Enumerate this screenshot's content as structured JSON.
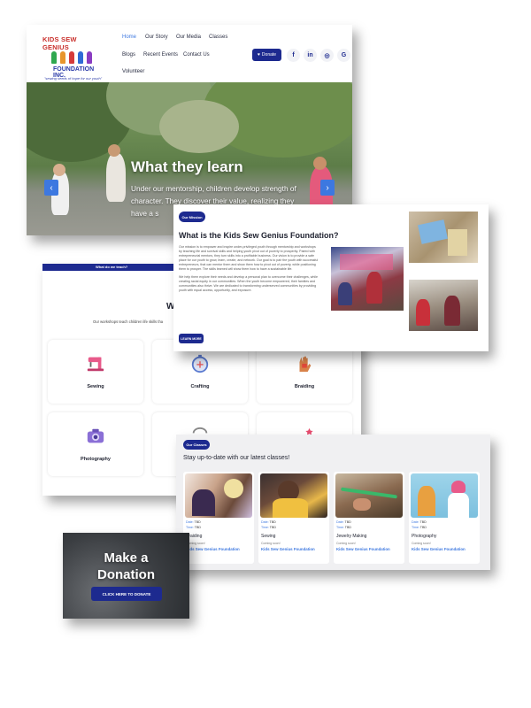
{
  "header": {
    "logo": {
      "arc": "KIDS SEW GENIUS",
      "foundation": "FOUNDATION INC.",
      "tagline": "\"sewing seeds of hope for our youth\""
    },
    "nav": [
      "Home",
      "Our Story",
      "Our Media",
      "Classes",
      "Blogs",
      "Recent Events",
      "Contact Us",
      "Volunteer"
    ],
    "donate_label": "Donate",
    "social_icons": [
      "facebook-icon",
      "linkedin-icon",
      "instagram-icon",
      "google-icon"
    ],
    "hero": {
      "title": "What they learn",
      "text": "Under our mentorship, children develop strength of character. They discover their value, realizing they have a s"
    }
  },
  "teach": {
    "tab": "What do we teach?",
    "heading": "W",
    "text": "Our workshops teach children life skills tha",
    "tiles": [
      "Sewing",
      "Crafting",
      "Braiding",
      "Photography",
      "",
      ""
    ]
  },
  "mission": {
    "pill": "Our Mission",
    "title": "What is the Kids Sew Genius Foundation?",
    "p1": "Our mission is to empower and inspire under-privileged youth through mentorship and workshops by teaching life and survival skills and helping youth pivot out of poverty to prosperity. Paired with entrepreneurial mentors, they turn skills into a profitable business. Our vision is to provide a safe place for our youth to grow, learn, create, and network. Our goal is to pair the youth with successful entrepreneurs, that can mentor them and show them how to pivot out of poverty, while positioning them to prosper. The skills learned will show them how to have a sustainable life.",
    "p2": "We help them explore their needs and develop a personal plan to overcome their challenges, while creating racial equity in our communities. When the youth become empowered, their families and communities also thrive. We are dedicated to transforming underserved communities by providing youth with equal access, opportunity, and exposure.",
    "button": "LEARN MORE"
  },
  "classes": {
    "pill": "Our Classes",
    "title": "Stay up-to-date with our latest classes!",
    "date_label": "Date:",
    "time_label": "Time:",
    "tbd": "TBD",
    "coming_soon": "Coming soon!",
    "items": [
      {
        "name": "Braiding",
        "org": "Kids Sew Genius Foundation"
      },
      {
        "name": "Sewing",
        "org": "Kids Sew Genius Foundation"
      },
      {
        "name": "Jewelry Making",
        "org": "Kids Sew Genius Foundation"
      },
      {
        "name": "Photography",
        "org": "Kids Sew Genius Foundation"
      }
    ]
  },
  "donation": {
    "title_line1": "Make a",
    "title_line2": "Donation",
    "button": "CLICK HERE TO DONATE"
  },
  "colors": {
    "navy": "#1d2a8f",
    "accent_blue": "#3d78e0"
  }
}
